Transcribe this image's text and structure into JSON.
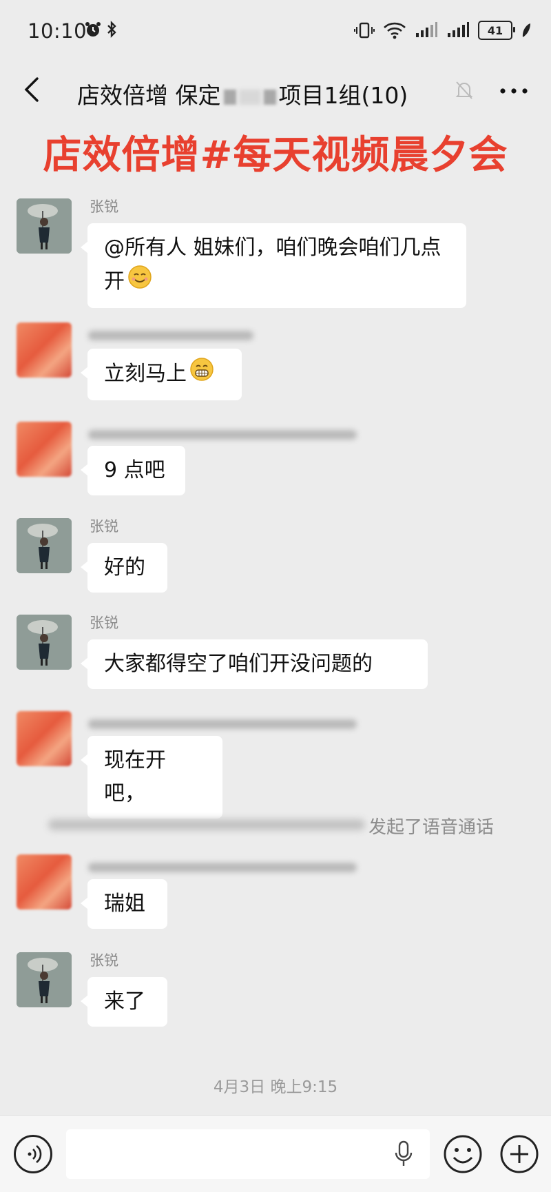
{
  "status_bar": {
    "time": "10:10",
    "battery": "41"
  },
  "header": {
    "title_prefix": "店效倍增 保定",
    "title_suffix": "项目1组(10)"
  },
  "banner": "店效倍增#每天视频晨夕会",
  "messages": [
    {
      "sender": "张锐",
      "text": "@所有人 姐妹们，咱们晚会咱们几点开",
      "emoji": "smiling-face-icon"
    },
    {
      "sender": "",
      "text": "立刻马上",
      "emoji": "grinning-face-icon"
    },
    {
      "sender": "",
      "text": "9 点吧"
    },
    {
      "sender": "张锐",
      "text": "好的"
    },
    {
      "sender": "张锐",
      "text": "大家都得空了咱们开没问题的"
    },
    {
      "sender": "",
      "text": "现在开吧，"
    },
    {
      "sender": "",
      "text": "瑞姐"
    },
    {
      "sender": "张锐",
      "text": "来了"
    }
  ],
  "system_notice": "发起了语音通话",
  "timestamp": "4月3日 晚上9:15",
  "input": {
    "placeholder": ""
  },
  "colors": {
    "banner": "#e8402f",
    "background": "#ececec",
    "bubble": "#ffffff"
  }
}
